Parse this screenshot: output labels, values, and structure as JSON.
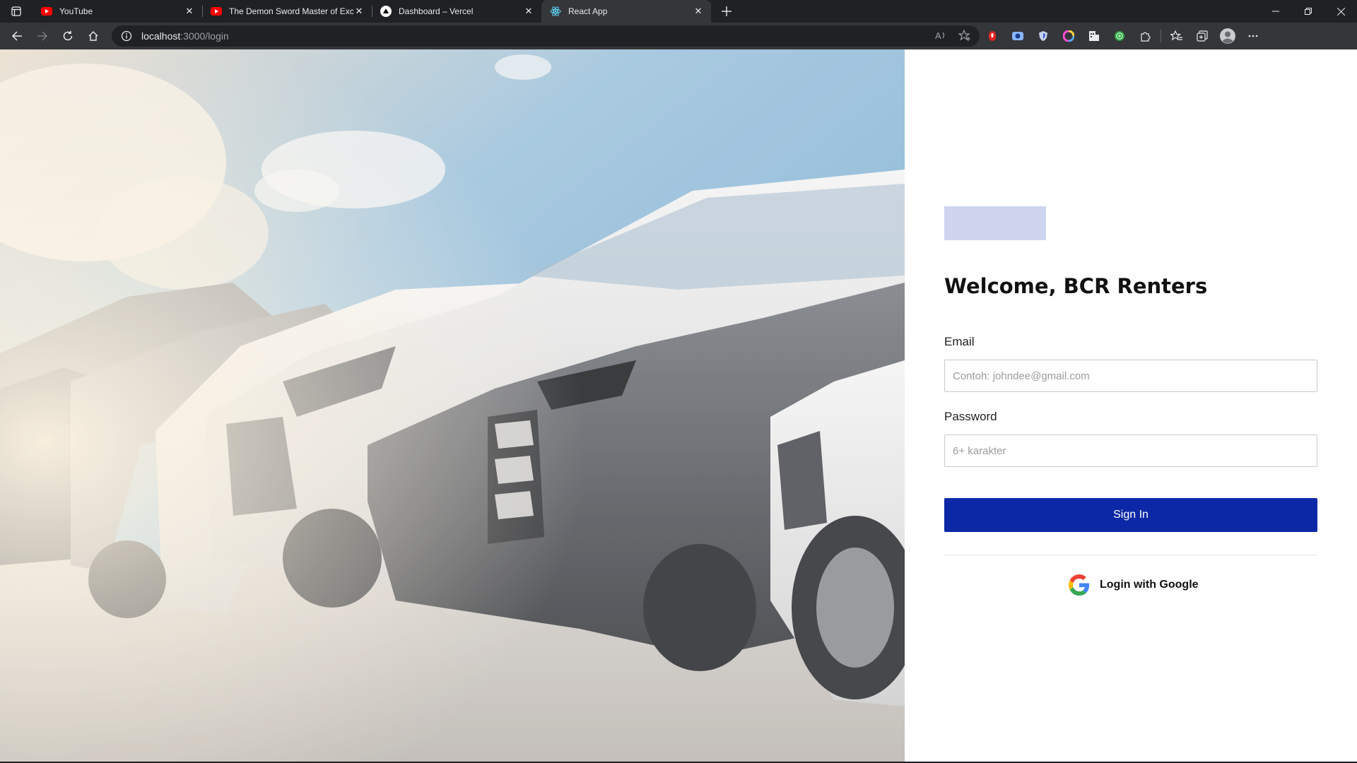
{
  "browser": {
    "tabs": [
      {
        "title": "YouTube",
        "icon": "youtube-icon",
        "active": false
      },
      {
        "title": "The Demon Sword Master of Excalibur Academy",
        "icon": "youtube-icon",
        "active": false
      },
      {
        "title": "Dashboard – Vercel",
        "icon": "vercel-icon",
        "active": false
      },
      {
        "title": "React App",
        "icon": "react-icon",
        "active": true
      }
    ],
    "url_host": "localhost",
    "url_path": ":3000/login"
  },
  "login": {
    "heading": "Welcome, BCR Renters",
    "email_label": "Email",
    "email_placeholder": "Contoh: johndee@gmail.com",
    "password_label": "Password",
    "password_placeholder": "6+ karakter",
    "signin_label": "Sign In",
    "google_label": "Login with Google"
  },
  "colors": {
    "primary": "#0d28a6",
    "logo_placeholder": "#cfd4ef"
  }
}
